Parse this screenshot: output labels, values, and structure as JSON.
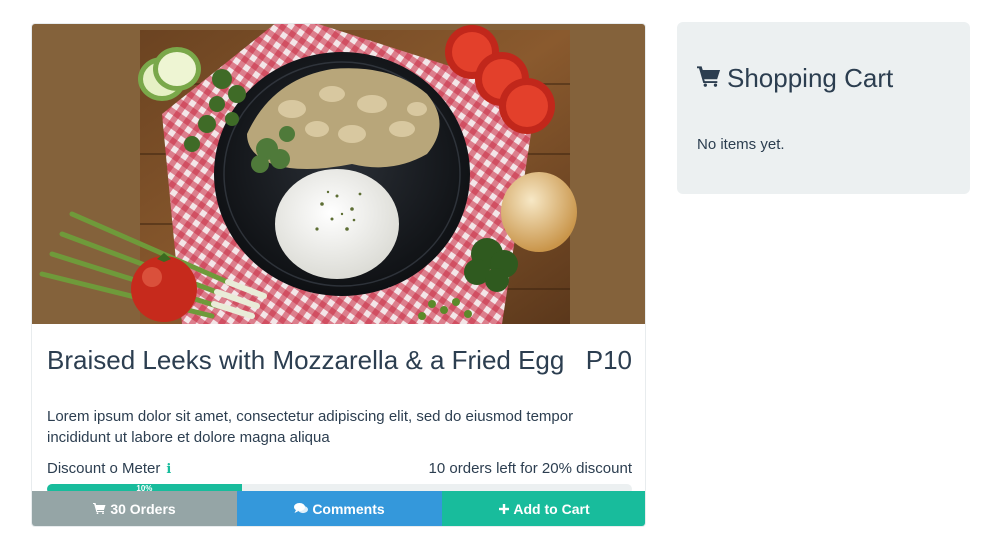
{
  "product": {
    "image_alt": "Plate of mushrooms, broccoli and rice on a checkered cloth",
    "title": "Braised Leeks with Mozzarella & a Fried Egg",
    "price": "P10",
    "description": "Lorem ipsum dolor sit amet, consectetur adipiscing elit, sed do eiusmod tempor incididunt ut labore et dolore magna aliqua",
    "meter_label": "Discount o Meter",
    "info_icon": "info-icon",
    "orders_left": "10 orders left for 20% discount",
    "progress": {
      "value": 0.1,
      "label": "10%"
    }
  },
  "actions": {
    "orders_label": "30 Orders",
    "orders_icon": "cart-icon",
    "comments_label": "Comments",
    "comments_icon": "comments-icon",
    "add_label": "Add to Cart",
    "add_icon": "plus-icon"
  },
  "cart": {
    "title": "Shopping Cart",
    "icon": "cart-icon",
    "empty_text": "No items yet."
  },
  "colors": {
    "primary_text": "#2c3e50",
    "success": "#18bc9c",
    "info": "#3498db",
    "muted": "#95a5a6",
    "panel_bg": "#ecf0f1"
  }
}
